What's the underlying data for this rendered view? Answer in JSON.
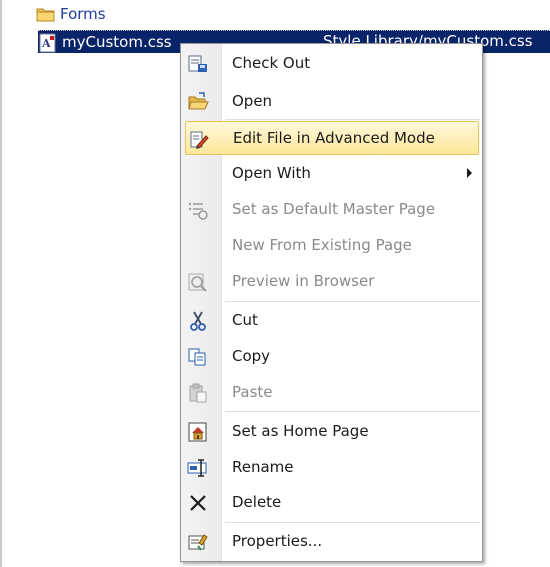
{
  "files": [
    {
      "name": "Forms",
      "icon": "folder-icon"
    },
    {
      "name": "myCustom.css",
      "path": "Style Library/myCustom.css",
      "icon": "css-file-icon"
    }
  ],
  "menu": {
    "items": [
      {
        "label": "Check Out",
        "icon": "check-out-icon",
        "enabled": true
      },
      {
        "label": "Open",
        "icon": "open-folder-icon",
        "enabled": true
      },
      {
        "label": "Edit File in Advanced Mode",
        "icon": "edit-advanced-icon",
        "enabled": true,
        "highlighted": true
      },
      {
        "label": "Open With",
        "icon": "",
        "enabled": true,
        "submenu": true
      },
      {
        "label": "Set as Default Master Page",
        "icon": "master-page-icon",
        "enabled": false
      },
      {
        "label": "New From Existing Page",
        "icon": "",
        "enabled": false
      },
      {
        "label": "Preview in Browser",
        "icon": "preview-browser-icon",
        "enabled": false
      },
      {
        "label": "Cut",
        "icon": "scissors-icon",
        "enabled": true
      },
      {
        "label": "Copy",
        "icon": "copy-icon",
        "enabled": true
      },
      {
        "label": "Paste",
        "icon": "paste-icon",
        "enabled": false
      },
      {
        "label": "Set as Home Page",
        "icon": "home-page-icon",
        "enabled": true
      },
      {
        "label": "Rename",
        "icon": "rename-icon",
        "enabled": true
      },
      {
        "label": "Delete",
        "icon": "delete-x-icon",
        "enabled": true
      },
      {
        "label": "Properties...",
        "icon": "properties-icon",
        "enabled": true
      }
    ]
  },
  "colors": {
    "selection": "#0a246a",
    "highlight": "#fde89a",
    "disabled_text": "#8a8a8a"
  }
}
